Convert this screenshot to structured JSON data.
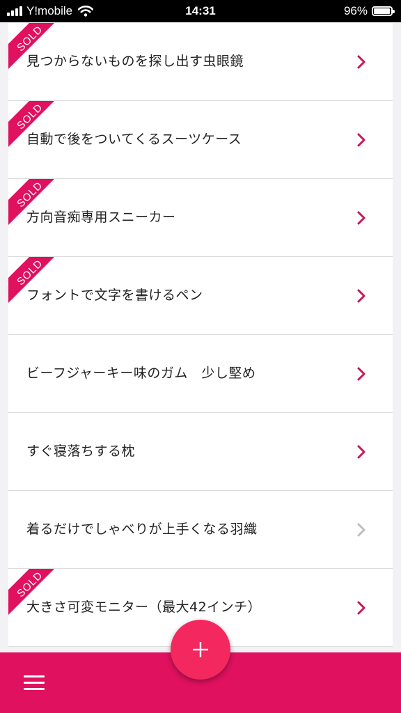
{
  "status_bar": {
    "carrier": "Y!mobile",
    "time": "14:31",
    "battery": "96%"
  },
  "colors": {
    "accent": "#e0115f",
    "fab": "#f3285f",
    "chevron_active": "#c2185b",
    "chevron_disabled": "#bdbdbd"
  },
  "items": [
    {
      "title": "見つからないものを探し出す虫眼鏡",
      "sold": "SOLD",
      "enabled": true
    },
    {
      "title": "自動で後をついてくるスーツケース",
      "sold": "SOLD",
      "enabled": true
    },
    {
      "title": "方向音痴専用スニーカー",
      "sold": "SOLD",
      "enabled": true
    },
    {
      "title": "フォントで文字を書けるペン",
      "sold": "SOLD",
      "enabled": true
    },
    {
      "title": "ビーフジャーキー味のガム　少し堅め",
      "sold": "",
      "enabled": true
    },
    {
      "title": "すぐ寝落ちする枕",
      "sold": "",
      "enabled": true
    },
    {
      "title": "着るだけでしゃべりが上手くなる羽織",
      "sold": "",
      "enabled": false
    },
    {
      "title": "大きさ可変モニター（最大42インチ）",
      "sold": "SOLD",
      "enabled": true
    }
  ],
  "icons": {
    "menu": "menu-icon",
    "add": "plus-icon",
    "row": "chevron-right-icon"
  }
}
